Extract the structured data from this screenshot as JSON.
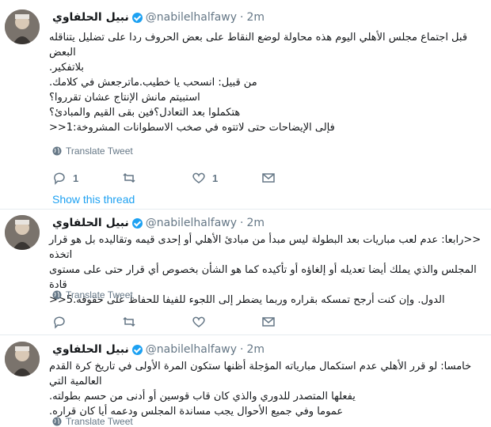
{
  "tweets": [
    {
      "display_name": "نبيل الحلفاوي",
      "handle": "@nabilelhalfawy",
      "separator": "·",
      "time": "2m",
      "lines": [
        "قبل اجتماع مجلس الأهلي اليوم هذه محاولة لوضع النقاط على بعض الحروف ردا على تضليل يتناقله البعض",
        "بلاتفكير.",
        "من قبيل: انسحب يا خطيب.ماترجعش في كلامك.",
        "استبيتم مانش الإنتاج عشان تقرروا؟",
        "هتكملوا بعد التعادل؟فين بقى القيم والمبادئ؟",
        "فإلى الإيضاحات حتى لاتتوه في صخب الاسطوانات المشروخة:1<<"
      ],
      "translate": "Translate Tweet",
      "reply_count": "1",
      "retweet_count": "",
      "like_count": "1",
      "show_thread": "Show this thread"
    },
    {
      "display_name": "نبيل الحلفاوي",
      "handle": "@nabilelhalfawy",
      "separator": "·",
      "time": "2m",
      "lines": [
        "<<رابعا: عدم لعب مباريات بعد البطولة ليس مبدأ من مبادئ الأهلي أو إحدى قيمه وتقاليده بل هو قرار اتخذه",
        "المجلس والذي يملك أيضا تعديله أو إلغاؤه أو تأكيده كما هو الشأن بخصوص أي قرار حتى على مستوى قادة",
        "الدول. وإن كنت أرجح تمسكه بقراره وربما يضطر إلى اللجوء للفيفا للحفاظ على حقوقه.5<<"
      ],
      "translate": "Translate Tweet",
      "reply_count": "",
      "retweet_count": "",
      "like_count": ""
    },
    {
      "display_name": "نبيل الحلفاوي",
      "handle": "@nabilelhalfawy",
      "separator": "·",
      "time": "2m",
      "lines": [
        "خامسا: لو قرر الأهلي عدم استكمال مبارياته المؤجلة أظنها ستكون المرة الأولى في تاريخ كرة القدم العالمية التي",
        "يفعلها المتصدر للدوري والذي كان قاب قوسين أو أدنى من حسم بطولته.",
        "عموما وفي جميع الأحوال يجب مساندة المجلس ودعمه أيا كان قراره."
      ],
      "translate": "Translate Tweet"
    }
  ],
  "colors": {
    "accent": "#1da1f2",
    "muted": "#657786",
    "text": "#14171a",
    "border": "#e6ecf0"
  }
}
